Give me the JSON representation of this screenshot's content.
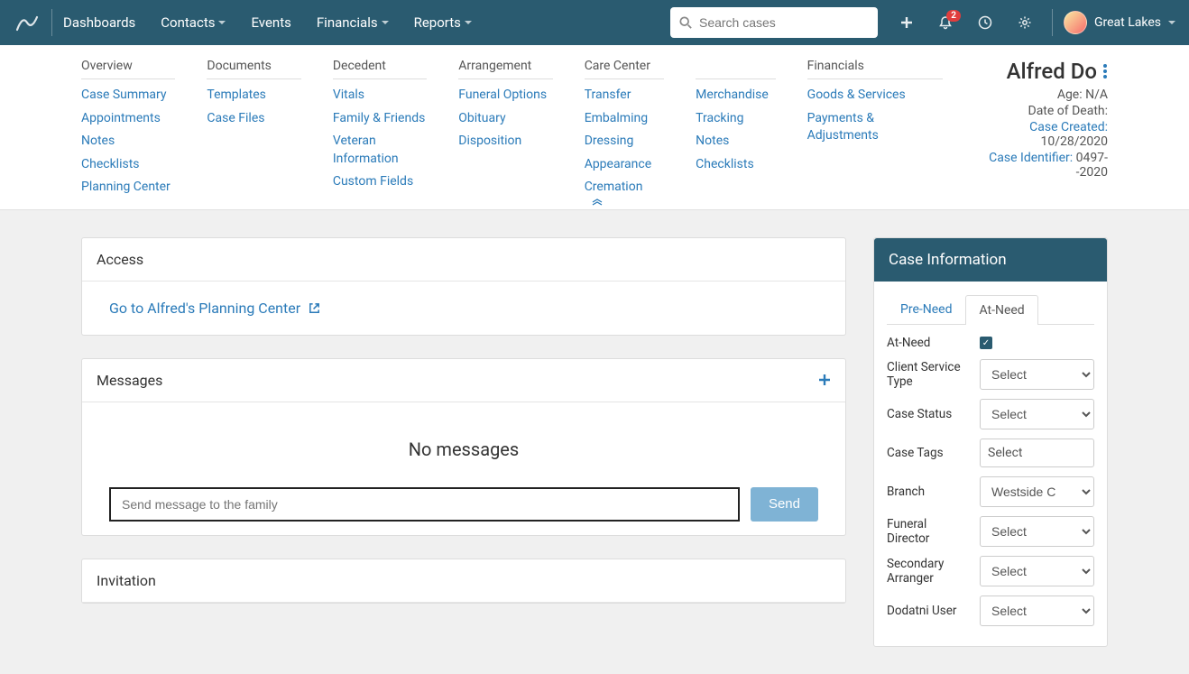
{
  "topnav": {
    "items": [
      {
        "label": "Dashboards",
        "dropdown": false
      },
      {
        "label": "Contacts",
        "dropdown": true
      },
      {
        "label": "Events",
        "dropdown": false
      },
      {
        "label": "Financials",
        "dropdown": true
      },
      {
        "label": "Reports",
        "dropdown": true
      }
    ],
    "search_placeholder": "Search cases",
    "notification_count": "2",
    "user_name": "Great Lakes"
  },
  "subnav": {
    "cols": [
      {
        "heading": "Overview",
        "links": [
          "Case Summary",
          "Appointments",
          "Notes",
          "Checklists",
          "Planning Center"
        ]
      },
      {
        "heading": "Documents",
        "links": [
          "Templates",
          "Case Files"
        ]
      },
      {
        "heading": "Decedent",
        "links": [
          "Vitals",
          "Family & Friends",
          "Veteran Information",
          "Custom Fields"
        ]
      },
      {
        "heading": "Arrangement",
        "links": [
          "Funeral Options",
          "Obituary",
          "Disposition"
        ]
      },
      {
        "heading": "Care Center",
        "links": [
          "Transfer",
          "Embalming",
          "Dressing",
          "Appearance",
          "Cremation"
        ]
      },
      {
        "heading": "",
        "links": [
          "Merchandise",
          "Tracking",
          "Notes",
          "Checklists"
        ]
      },
      {
        "heading": "Financials",
        "links": [
          "Goods & Services",
          "Payments & Adjustments"
        ]
      }
    ]
  },
  "case": {
    "name": "Alfred Do",
    "age_label": "Age:",
    "age_value": "N/A",
    "dod_label": "Date of Death:",
    "dod_value": "",
    "created_label": "Case Created:",
    "created_value": "10/28/2020",
    "identifier_label": "Case Identifier:",
    "identifier_value": "0497--2020"
  },
  "access": {
    "heading": "Access",
    "link": "Go to Alfred's Planning Center"
  },
  "messages": {
    "heading": "Messages",
    "empty": "No messages",
    "placeholder": "Send message to the family",
    "send": "Send"
  },
  "invitation": {
    "heading": "Invitation"
  },
  "sidepanel": {
    "heading": "Case Information",
    "tabs": [
      "Pre-Need",
      "At-Need"
    ],
    "active_tab": 1,
    "fields": {
      "at_need": "At-Need",
      "client_service_type": "Client Service Type",
      "case_status": "Case Status",
      "case_tags": "Case Tags",
      "branch": "Branch",
      "funeral_director": "Funeral Director",
      "secondary_arranger": "Secondary Arranger",
      "dodatni_user": "Dodatni User"
    },
    "values": {
      "client_service_type": "Select",
      "case_status": "Select",
      "case_tags": "Select",
      "branch": "Westside C",
      "funeral_director": "Select",
      "secondary_arranger": "Select",
      "dodatni_user": "Select"
    }
  }
}
